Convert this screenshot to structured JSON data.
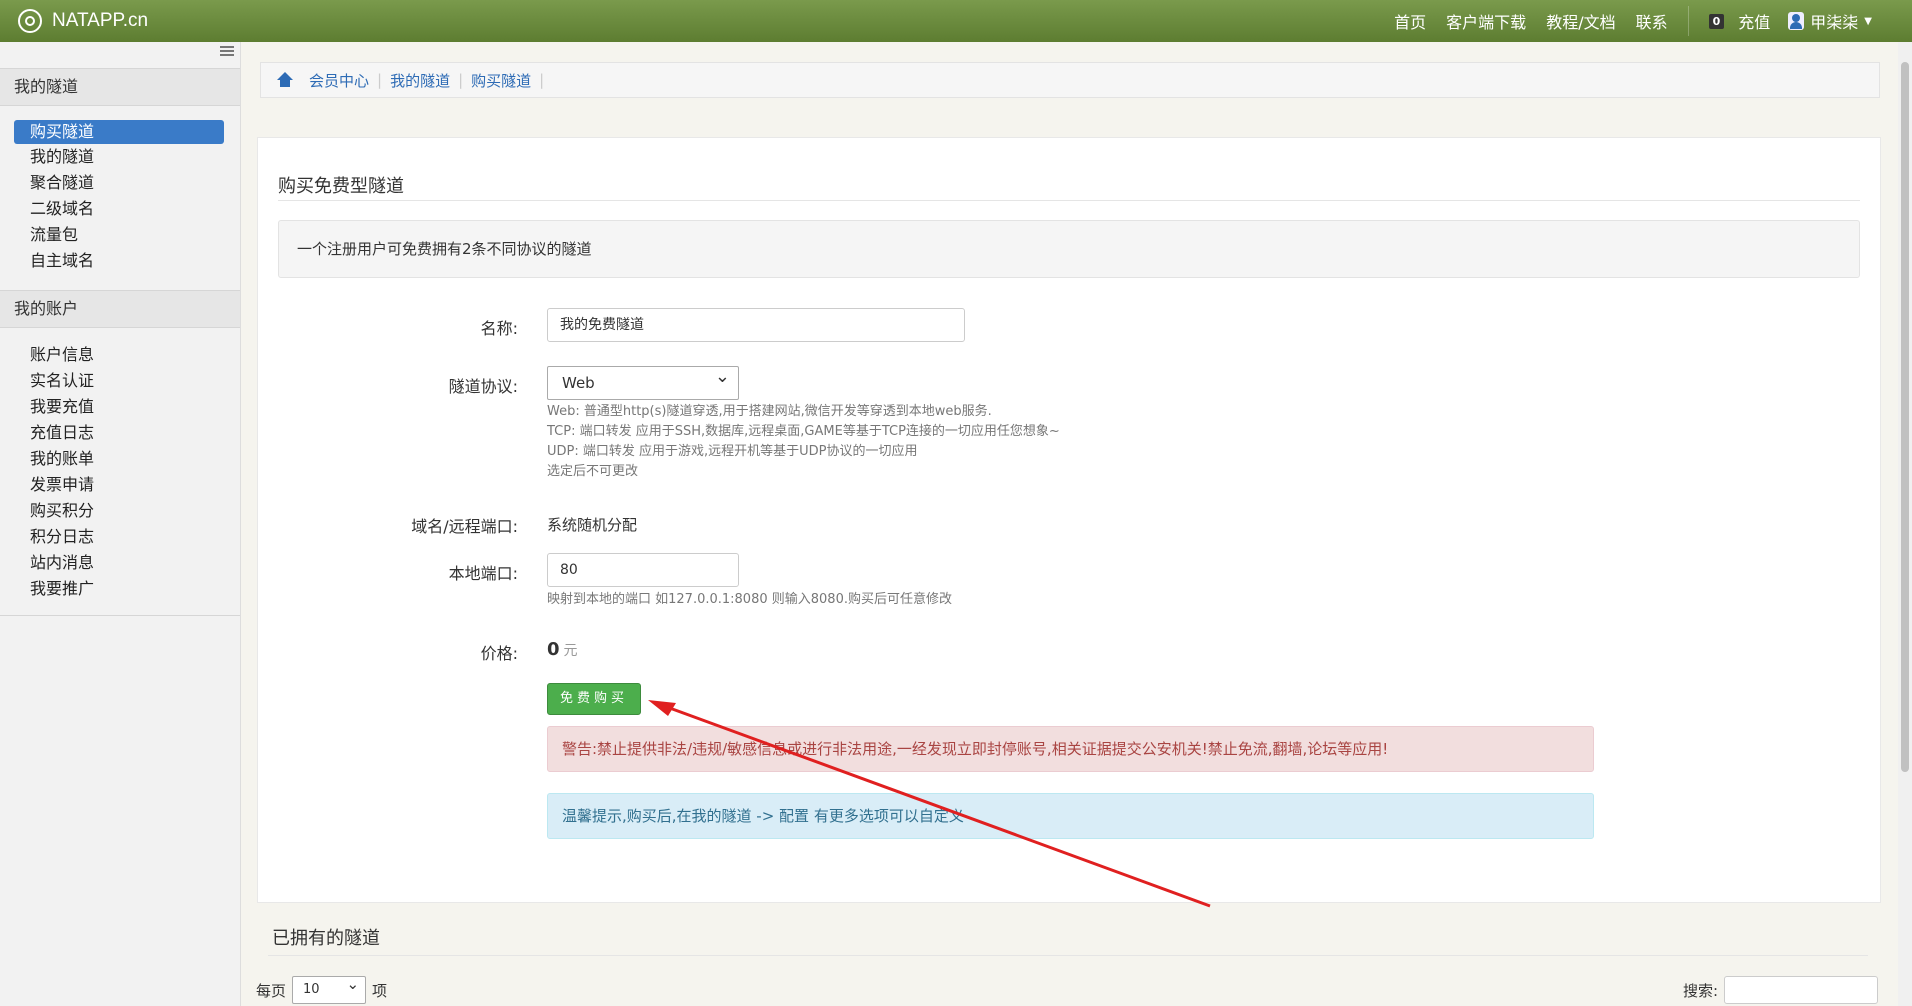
{
  "brand": {
    "name": "NATAPP.cn"
  },
  "topnav": {
    "items": [
      "首页",
      "客户端下载",
      "教程/文档",
      "联系"
    ],
    "wallet_badge": "0",
    "recharge": "充值",
    "username": "甲柒柒"
  },
  "sidebar": {
    "section1_title": "我的隧道",
    "section1_items": [
      "购买隧道",
      "我的隧道",
      "聚合隧道",
      "二级域名",
      "流量包",
      "自主域名"
    ],
    "section2_title": "我的账户",
    "section2_items": [
      "账户信息",
      "实名认证",
      "我要充值",
      "充值日志",
      "我的账单",
      "发票申请",
      "购买积分",
      "积分日志",
      "站内消息",
      "我要推广"
    ]
  },
  "breadcrumb": [
    "会员中心",
    "我的隧道",
    "购买隧道"
  ],
  "form": {
    "title": "购买免费型隧道",
    "notice": "一个注册用户可免费拥有2条不同协议的隧道",
    "name_label": "名称:",
    "name_value": "我的免费隧道",
    "protocol_label": "隧道协议:",
    "protocol_value": "Web",
    "protocol_help": [
      "Web: 普通型http(s)隧道穿透,用于搭建网站,微信开发等穿透到本地web服务.",
      "TCP: 端口转发 应用于SSH,数据库,远程桌面,GAME等基于TCP连接的一切应用任您想象~",
      "UDP: 端口转发 应用于游戏,远程开机等基于UDP协议的一切应用",
      "选定后不可更改"
    ],
    "domain_label": "域名/远程端口:",
    "domain_value": "系统随机分配",
    "port_label": "本地端口:",
    "port_value": "80",
    "port_help": "映射到本地的端口 如127.0.0.1:8080 则输入8080.购买后可任意修改",
    "price_label": "价格:",
    "price_value": "0",
    "price_unit": "元",
    "buy_button": "免费购买",
    "warning": "警告:禁止提供非法/违规/敏感信息或进行非法用途,一经发现立即封停账号,相关证据提交公安机关!禁止免流,翻墙,论坛等应用!",
    "tip": "温馨提示,购买后,在我的隧道 -> 配置 有更多选项可以自定义"
  },
  "owned": {
    "title": "已拥有的隧道",
    "per_page_prefix": "每页",
    "per_page_value": "10",
    "per_page_suffix": "项",
    "search_label": "搜索:"
  },
  "colors": {
    "navbar": "#6b8b3e",
    "active": "#3a7bc8",
    "button": "#4cae4c",
    "annotation_arrow": "#e02020"
  }
}
